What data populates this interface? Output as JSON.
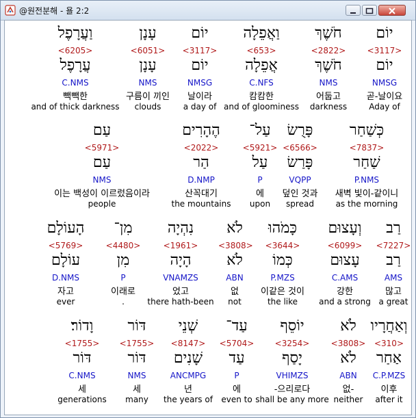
{
  "window": {
    "title": "@원전분해 - 욜 2:2"
  },
  "rows": [
    [
      {
        "heb": "יוֹם",
        "num": "<3117>",
        "lemma": "יוֹם",
        "gram": "NMSG",
        "kor": "곧-날이요",
        "eng": "Aday of",
        "selected": true
      },
      {
        "heb": "חֹשֶׁךְ",
        "num": "<2822>",
        "lemma": "חֹשֶׁךְ",
        "gram": "NMS",
        "kor": "어둡고",
        "eng": "darkness"
      },
      {
        "heb": "וַאֲפֵלָה",
        "num": "<653>",
        "lemma": "אֲפֵלָה",
        "gram": "C.NFS",
        "kor": "캄캄한",
        "eng": "and of gloominess"
      },
      {
        "heb": "יוֹם",
        "num": "<3117>",
        "lemma": "יוֹם",
        "gram": "NMSG",
        "kor": "날이라",
        "eng": "a day of"
      },
      {
        "heb": "עָנָן",
        "num": "<6051>",
        "lemma": "עָנָן",
        "gram": "NMS",
        "kor": "구름이 끼인",
        "eng": "clouds"
      },
      {
        "heb": "וַעֲרָפֶל",
        "num": "<6205>",
        "lemma": "עֲרָפֶל",
        "gram": "C.NMS",
        "kor": "빽빽한",
        "eng": "and of thick darkness"
      }
    ],
    [
      {
        "heb": "כְּשַׁחַר",
        "num": "<7837>",
        "lemma": "שַׁחַר",
        "gram": "P.NMS",
        "kor": "새벽 빛이-같이니",
        "eng": "as the morning"
      },
      {
        "heb": "פָּרֻשׂ",
        "num": "<6566>",
        "lemma": "פָּרַשׂ",
        "gram": "VQPP",
        "kor": "덮인 것과",
        "eng": "spread"
      },
      {
        "heb": "עַל־",
        "num": "<5921>",
        "lemma": "עַל",
        "gram": "P",
        "kor": "에",
        "eng": "upon"
      },
      {
        "heb": "הֶהָרִים",
        "num": "<2022>",
        "lemma": "הַר",
        "gram": "D.NMP",
        "kor": "산꼭대기",
        "eng": "the mountains"
      },
      {
        "heb": "עַם",
        "num": "<5971>",
        "lemma": "עַם",
        "gram": "NMS",
        "kor": "이는 백성이 이르렀음이라",
        "eng": "people"
      }
    ],
    [
      {
        "heb": "רַב",
        "num": "<7227>",
        "lemma": "רַב",
        "gram": "AMS",
        "kor": "많고",
        "eng": "a great"
      },
      {
        "heb": "וְעָצוּם",
        "num": "<6099>",
        "lemma": "עָצוּם",
        "gram": "C.AMS",
        "kor": "강한",
        "eng": "and a strong"
      },
      {
        "heb": "כָּמֹהוּ",
        "num": "<3644>",
        "lemma": "כְּמוֹ",
        "gram": "P.MZS",
        "kor": "이같은 것이",
        "eng": "the like"
      },
      {
        "heb": "לֹא",
        "num": "<3808>",
        "lemma": "לֹא",
        "gram": "ABN",
        "kor": "없",
        "eng": "not"
      },
      {
        "heb": "נִהְיָה",
        "num": "<1961>",
        "lemma": "הָיָה",
        "gram": "VNAMZS",
        "kor": "었고",
        "eng": "there hath-been"
      },
      {
        "heb": "מִן־",
        "num": "<4480>",
        "lemma": "מִן",
        "gram": "P",
        "kor": "이래로",
        "eng": "."
      },
      {
        "heb": "הָעוֹלָם",
        "num": "<5769>",
        "lemma": "עוֹלָם",
        "gram": "D.NMS",
        "kor": "자고",
        "eng": "ever"
      }
    ],
    [
      {
        "heb": "וְאַחֲרָיו",
        "num": "<310>",
        "lemma": "אַחַר",
        "gram": "C.P.MZS",
        "kor": "이후",
        "eng": "after it"
      },
      {
        "heb": "לֹא",
        "num": "<3808>",
        "lemma": "לֹא",
        "gram": "ABN",
        "kor": "없-",
        "eng": "neither"
      },
      {
        "heb": "יוֹסֵף",
        "num": "<3254>",
        "lemma": "יָסַף",
        "gram": "VHIMZS",
        "kor": "-으리로다",
        "eng": "shall be any more"
      },
      {
        "heb": "עַד־",
        "num": "<5704>",
        "lemma": "עַד",
        "gram": "P",
        "kor": "에",
        "eng": "even to"
      },
      {
        "heb": "שְׁנֵי",
        "num": "<8147>",
        "lemma": "שָׁנִים",
        "gram": "ANCMPG",
        "kor": "년",
        "eng": "the years of"
      },
      {
        "heb": "דּוֹר",
        "num": "<1755>",
        "lemma": "דּוֹר",
        "gram": "NMS",
        "kor": "세",
        "eng": "many"
      },
      {
        "heb": "וָדוֹר׃",
        "num": "<1755>",
        "lemma": "דּוֹר",
        "gram": "C.NMS",
        "kor": "세",
        "eng": "generations"
      }
    ]
  ]
}
